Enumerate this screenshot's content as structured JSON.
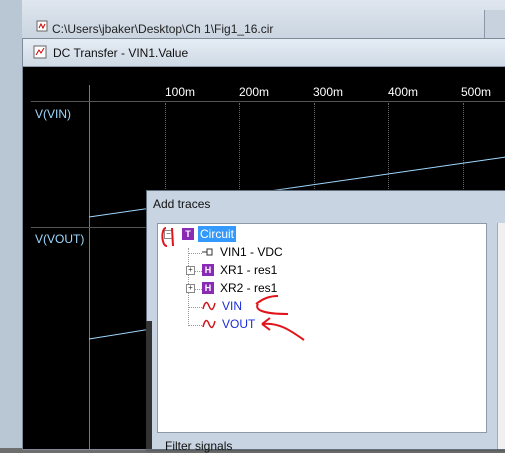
{
  "back_window": {
    "title": "C:\\Users\\jbaker\\Desktop\\Ch 1\\Fig1_16.cir"
  },
  "plot_window": {
    "title": "DC Transfer - VIN1.Value",
    "x_ticks": [
      "100m",
      "200m",
      "300m",
      "400m",
      "500m"
    ],
    "signals": [
      "V(VIN)",
      "V(VOUT)"
    ]
  },
  "dialog": {
    "title": "Add traces",
    "tree": {
      "root": "Circuit",
      "children": [
        {
          "label": "VIN1 - VDC",
          "kind": "source"
        },
        {
          "label": "XR1 - res1",
          "kind": "subcircuit"
        },
        {
          "label": "XR2 - res1",
          "kind": "subcircuit"
        },
        {
          "label": "VIN",
          "kind": "signal"
        },
        {
          "label": "VOUT",
          "kind": "signal"
        }
      ]
    },
    "filter_label": "Filter signals"
  },
  "colors": {
    "trace": "#9fd8ff",
    "annotation": "#e0141a",
    "selection": "#3399ff"
  },
  "icons": {
    "root": "T",
    "subcircuit": "H"
  }
}
